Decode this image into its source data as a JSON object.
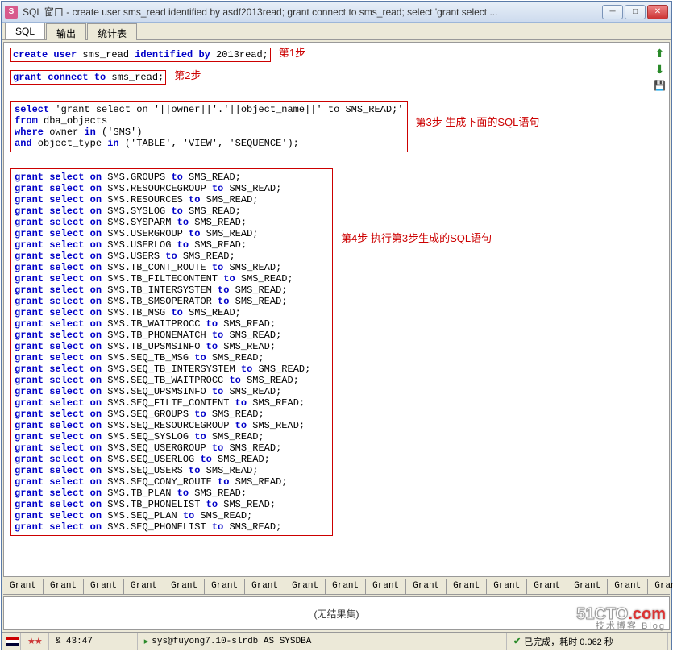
{
  "window": {
    "title": "SQL 窗口 - create user sms_read identified by asdf2013read;  grant connect to sms_read;  select 'grant select ..."
  },
  "tabs": {
    "sql": "SQL",
    "output": "输出",
    "stats": "统计表"
  },
  "annotations": {
    "step1": "第1步",
    "step2": "第2步",
    "step3": "第3步 生成下面的SQL语句",
    "step4": "第4步 执行第3步生成的SQL语句"
  },
  "sql_blocks": {
    "block1_pre": "create user",
    "block1_mid": " sms_read ",
    "block1_post": "identified by",
    "block1_end": " 2013read;",
    "block2_pre": "grant connect to",
    "block2_end": " sms_read;",
    "block3_l1a": "select",
    "block3_l1b": " 'grant select on '||owner||'.'||object_name||' to SMS_READ;'",
    "block3_l2a": "from",
    "block3_l2b": " dba_objects",
    "block3_l3a": "where",
    "block3_l3b": " owner ",
    "block3_l3c": "in",
    "block3_l3d": " ('SMS')",
    "block3_l4a": "and",
    "block3_l4b": " object_type ",
    "block3_l4c": "in",
    "block3_l4d": " ('TABLE', 'VIEW', 'SEQUENCE');"
  },
  "grants": [
    "SMS.GROUPS",
    "SMS.RESOURCEGROUP",
    "SMS.RESOURCES",
    "SMS.SYSLOG",
    "SMS.SYSPARM",
    "SMS.USERGROUP",
    "SMS.USERLOG",
    "SMS.USERS",
    "SMS.TB_CONT_ROUTE",
    "SMS.TB_FILTECONTENT",
    "SMS.TB_INTERSYSTEM",
    "SMS.TB_SMSOPERATOR",
    "SMS.TB_MSG",
    "SMS.TB_WAITPROCC",
    "SMS.TB_PHONEMATCH",
    "SMS.TB_UPSMSINFO",
    "SMS.SEQ_TB_MSG",
    "SMS.SEQ_TB_INTERSYSTEM",
    "SMS.SEQ_TB_WAITPROCC",
    "SMS.SEQ_UPSMSINFO",
    "SMS.SEQ_FILTE_CONTENT",
    "SMS.SEQ_GROUPS",
    "SMS.SEQ_RESOURCEGROUP",
    "SMS.SEQ_SYSLOG",
    "SMS.SEQ_USERGROUP",
    "SMS.SEQ_USERLOG",
    "SMS.SEQ_USERS",
    "SMS.SEQ_CONY_ROUTE",
    "SMS.TB_PLAN",
    "SMS.TB_PHONELIST",
    "SMS.SEQ_PLAN",
    "SMS.SEQ_PHONELIST"
  ],
  "grant_prefix": "grant select on",
  "grant_mid": " to",
  "grant_target": " SMS_READ;",
  "bottom_tabs": [
    "Grant ",
    "Grant ",
    "Grant ",
    "Grant ",
    "Grant ",
    "Grant ",
    "Grant ",
    "Grant ",
    "Grant ",
    "Grant ",
    "Grant ",
    "Grant ",
    "Grant ",
    "Grant ",
    "Grant ",
    "Grant ",
    "Grant "
  ],
  "result": "(无结果集)",
  "status": {
    "pos": "& 43:47",
    "conn": "sys@fuyong7.10-slrdb AS SYSDBA",
    "done": "已完成，耗时 0.062 秒"
  },
  "watermark": {
    "a": "51CTO",
    "b": ".com",
    "sub": "技术博客   Blog"
  }
}
